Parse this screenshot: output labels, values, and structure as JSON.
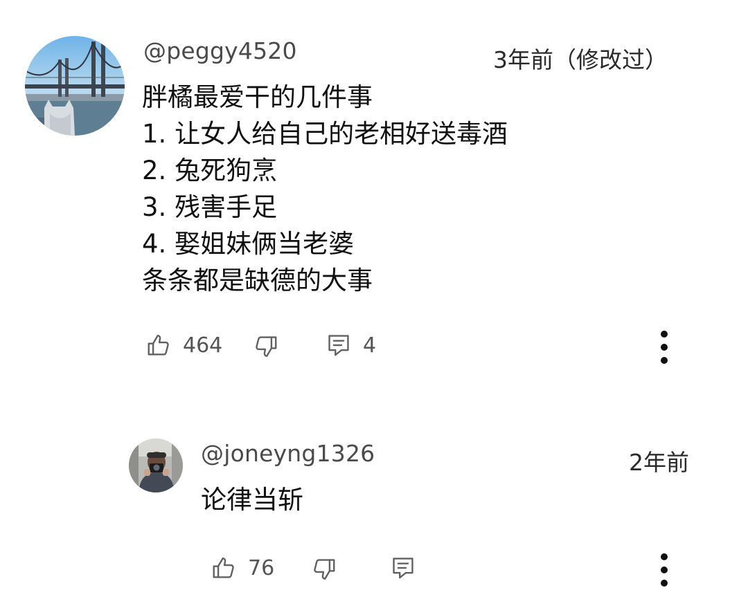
{
  "comments": [
    {
      "handle": "@peggy4520",
      "time": "3年前（修改过）",
      "lines": [
        "胖橘最爱干的几件事",
        "1. 让女人给自己的老相好送毒酒",
        "2. 兔死狗烹",
        "3. 残害手足",
        "4. 娶姐妹俩当老婆",
        "条条都是缺德的大事"
      ],
      "likes": "464",
      "replies": "4",
      "avatar_icon": "bridge-photo-avatar"
    },
    {
      "handle": "@joneyng1326",
      "time": "2年前",
      "lines": [
        "论律当斩"
      ],
      "likes": "76",
      "avatar_icon": "person-with-camera-avatar"
    }
  ],
  "icons": {
    "like": "thumbs-up-icon",
    "dislike": "thumbs-down-icon",
    "reply": "comment-icon",
    "more": "more-vertical-icon"
  },
  "colors": {
    "text": "#111111",
    "secondary": "#555555",
    "icon": "#606060",
    "background": "#ffffff"
  }
}
